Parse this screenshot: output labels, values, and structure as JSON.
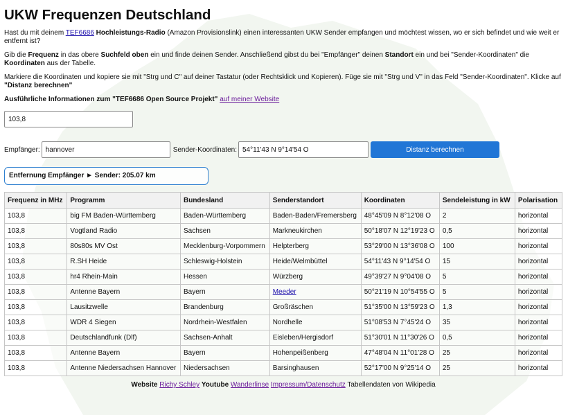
{
  "page": {
    "title": "UKW Frequenzen Deutschland",
    "intro1": {
      "pre": "Hast du mit deinem ",
      "link": "TEF6686",
      "bold": "Hochleistungs-Radio",
      "post": " (Amazon Provisionslink) einen interessanten UKW Sender empfangen und möchtest wissen, wo er sich befindet und wie weit er entfernt ist?"
    },
    "intro2": {
      "a": "Gib die ",
      "b1": "Frequenz",
      "c": " in das obere ",
      "b2": "Suchfeld oben",
      "d": " ein und finde deinen Sender. Anschließend gibst du bei \"Empfänger\" deinen ",
      "b3": "Standort",
      "e": " ein und bei \"Sender-Koordinaten\" die ",
      "b4": "Koordinaten",
      "f": " aus der Tabelle."
    },
    "intro3": {
      "a": "Markiere die Koordinaten und kopiere sie mit \"Strg und C\" auf deiner Tastatur (oder Rechtsklick und Kopieren). Füge sie mit \"Strg und V\" in das Feld \"Sender-Koordinaten\". Klicke auf ",
      "b": "\"Distanz berechnen\""
    },
    "info": {
      "bold": "Ausführliche Informationen zum \"TEF6686 Open Source Projekt\"",
      "link": "auf meiner Website"
    }
  },
  "search": {
    "value": "103,8"
  },
  "distance_form": {
    "receiver_label": "Empfänger:",
    "receiver_value": "hannover",
    "coords_label": "Sender-Koordinaten:",
    "coords_value": "54°11'43 N 9°14'54 O",
    "button_label": "Distanz berechnen",
    "result": "Entfernung Empfänger ► Sender: 205.07 km"
  },
  "table": {
    "headers": [
      "Frequenz in MHz",
      "Programm",
      "Bundesland",
      "Senderstandort",
      "Koordinaten",
      "Sendeleistung in kW",
      "Polarisation"
    ],
    "rows": [
      [
        "103,8",
        "big FM Baden-Württemberg",
        "Baden-Württemberg",
        "Baden-Baden/Fremersberg",
        "48°45'09 N 8°12'08 O",
        "2",
        "horizontal"
      ],
      [
        "103,8",
        "Vogtland Radio",
        "Sachsen",
        "Markneukirchen",
        "50°18'07 N 12°19'23 O",
        "0,5",
        "horizontal"
      ],
      [
        "103,8",
        "80s80s MV Ost",
        "Mecklenburg-Vorpommern",
        "Helpterberg",
        "53°29'00 N 13°36'08 O",
        "100",
        "horizontal"
      ],
      [
        "103,8",
        "R.SH Heide",
        "Schleswig-Holstein",
        "Heide/Welmbüttel",
        "54°11'43 N 9°14'54 O",
        "15",
        "horizontal"
      ],
      [
        "103,8",
        "hr4 Rhein-Main",
        "Hessen",
        "Würzberg",
        "49°39'27 N 9°04'08 O",
        "5",
        "horizontal"
      ],
      [
        "103,8",
        "Antenne Bayern",
        "Bayern",
        "Meeder",
        "50°21'19 N 10°54'55 O",
        "5",
        "horizontal"
      ],
      [
        "103,8",
        "Lausitzwelle",
        "Brandenburg",
        "Großräschen",
        "51°35'00 N 13°59'23 O",
        "1,3",
        "horizontal"
      ],
      [
        "103,8",
        "WDR 4 Siegen",
        "Nordrhein-Westfalen",
        "Nordhelle",
        "51°08'53 N 7°45'24 O",
        "35",
        "horizontal"
      ],
      [
        "103,8",
        "Deutschlandfunk (Dlf)",
        "Sachsen-Anhalt",
        "Eisleben/Hergisdorf",
        "51°30'01 N 11°30'26 O",
        "0,5",
        "horizontal"
      ],
      [
        "103,8",
        "Antenne Bayern",
        "Bayern",
        "Hohenpeißenberg",
        "47°48'04 N 11°01'28 O",
        "25",
        "horizontal"
      ],
      [
        "103,8",
        "Antenne Niedersachsen Hannover",
        "Niedersachsen",
        "Barsinghausen",
        "52°17'00 N 9°25'14 O",
        "25",
        "horizontal"
      ]
    ],
    "linked_cell": {
      "row": 5,
      "col": 3
    }
  },
  "footer": {
    "website_label": "Website",
    "website_link": "Richy Schley",
    "youtube_label": "Youtube",
    "youtube_link": "Wanderlinse",
    "impressum_link": "Impressum/Datenschutz",
    "source_text": "Tabellendaten von Wikipedia"
  },
  "colors": {
    "button": "#2176d6",
    "link": "#1a0dab",
    "visited_link": "#6a1b9a",
    "result_border": "#2f80d0"
  }
}
